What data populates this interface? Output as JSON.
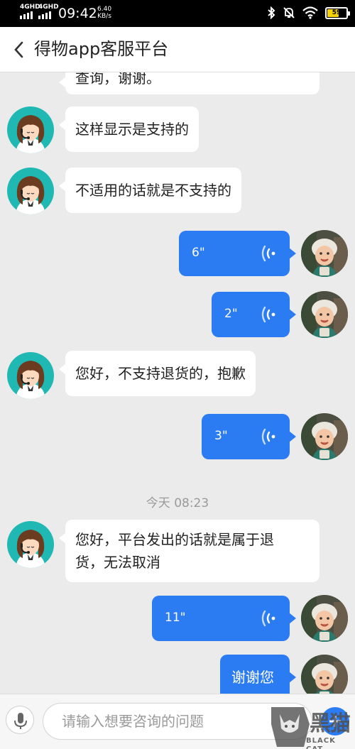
{
  "status_bar": {
    "network_1": "4GHD",
    "network_2": "4GHD",
    "time": "09:42",
    "speed_value": "6.40",
    "speed_unit": "KB/s",
    "battery": "59",
    "icons": [
      "bluetooth-icon",
      "mute-icon",
      "wifi-icon",
      "battery-icon"
    ]
  },
  "header": {
    "title": "得物app客服平台",
    "back_icon": "chevron-left-icon"
  },
  "chat": {
    "messages": [
      {
        "side": "in",
        "type": "text",
        "lines": [
          "查询，谢谢。"
        ]
      },
      {
        "side": "in",
        "type": "text",
        "lines": [
          "这样显示是支持的"
        ]
      },
      {
        "side": "in",
        "type": "text",
        "lines": [
          "不适用的话就是不支持的"
        ]
      },
      {
        "side": "out",
        "type": "voice",
        "duration": "6\""
      },
      {
        "side": "out",
        "type": "voice",
        "duration": "2\""
      },
      {
        "side": "in",
        "type": "text",
        "lines": [
          "您好，不支持退货的，抱歉"
        ]
      },
      {
        "side": "out",
        "type": "voice",
        "duration": "3\""
      },
      {
        "side": "in",
        "type": "text",
        "lines": [
          "您好，平台发出的话就是属于退",
          "货，无法取消"
        ]
      },
      {
        "side": "out",
        "type": "voice",
        "duration": "11\""
      },
      {
        "side": "out",
        "type": "text",
        "lines": [
          "谢谢您"
        ]
      }
    ],
    "time_divider": "今天 08:23"
  },
  "input_bar": {
    "placeholder": "请输入想要咨询的问题",
    "mic_icon": "microphone-icon",
    "send_icon": "plus-icon"
  },
  "watermark": {
    "text": "黑猫",
    "subtext": "BLACK CAT"
  },
  "colors": {
    "accent": "#2b7bf3",
    "background": "#ebebeb",
    "agent_avatar_bg": "#1fb8b3"
  }
}
